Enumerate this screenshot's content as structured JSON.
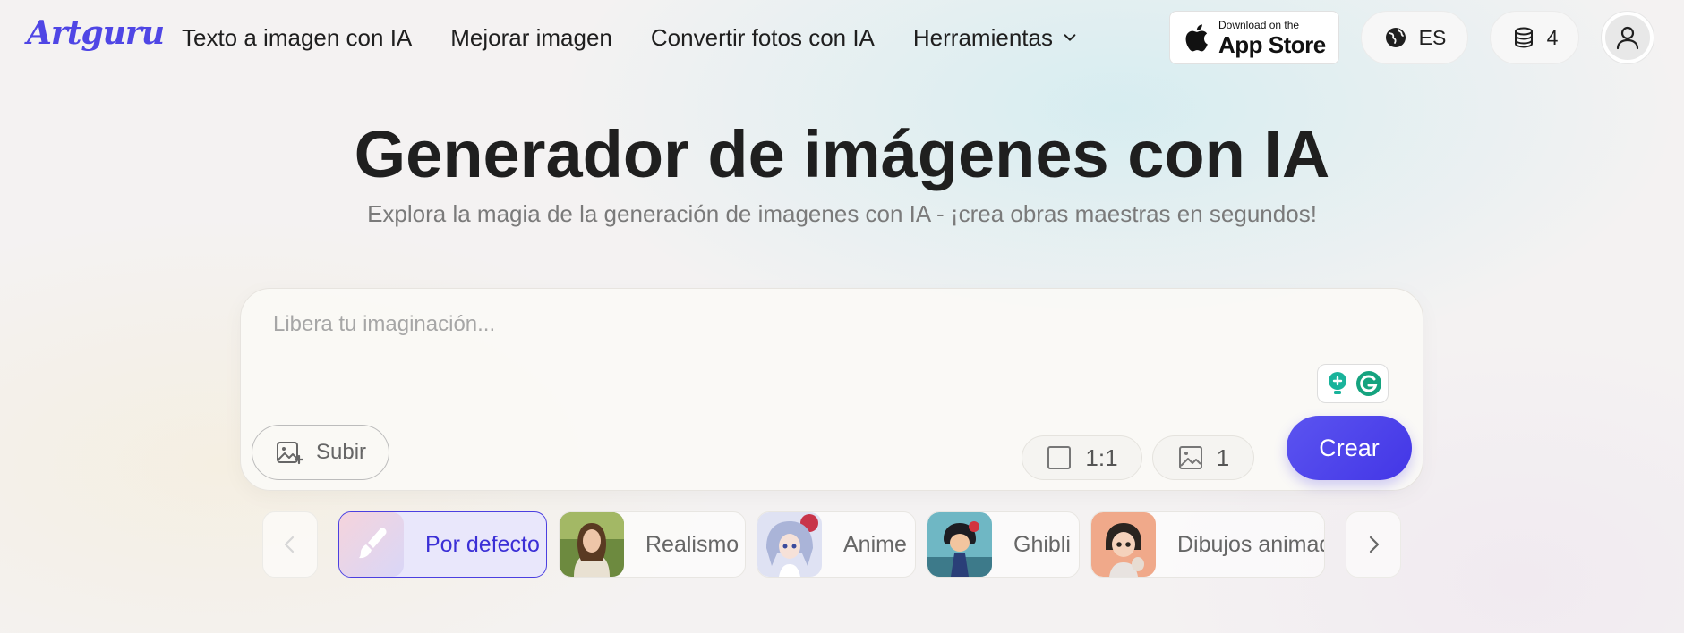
{
  "header": {
    "logo": "Artguru",
    "nav": [
      {
        "label": "Texto a imagen con IA"
      },
      {
        "label": "Mejorar imagen"
      },
      {
        "label": "Convertir fotos con IA"
      },
      {
        "label": "Herramientas",
        "has_dropdown": true
      }
    ],
    "app_store": {
      "small": "Download on the",
      "big": "App Store"
    },
    "language": "ES",
    "credits": "4"
  },
  "hero": {
    "title": "Generador de imágenes con IA",
    "subtitle": "Explora la magia de la generación de imagenes con IA - ¡crea obras maestras en segundos!"
  },
  "prompt": {
    "placeholder": "Libera tu imaginación...",
    "value": "",
    "upload_label": "Subir",
    "ratio": "1:1",
    "count": "1",
    "create_label": "Crear"
  },
  "styles": [
    {
      "label": "Por defecto",
      "icon": "brush-icon",
      "active": true
    },
    {
      "label": "Realismo",
      "active": false
    },
    {
      "label": "Anime",
      "active": false
    },
    {
      "label": "Ghibli",
      "active": false
    },
    {
      "label": "Dibujos animados",
      "active": false
    }
  ],
  "colors": {
    "accent": "#4f46e5",
    "button": "#4b3fe8",
    "active_chip_bg": "#e9e7fb"
  }
}
